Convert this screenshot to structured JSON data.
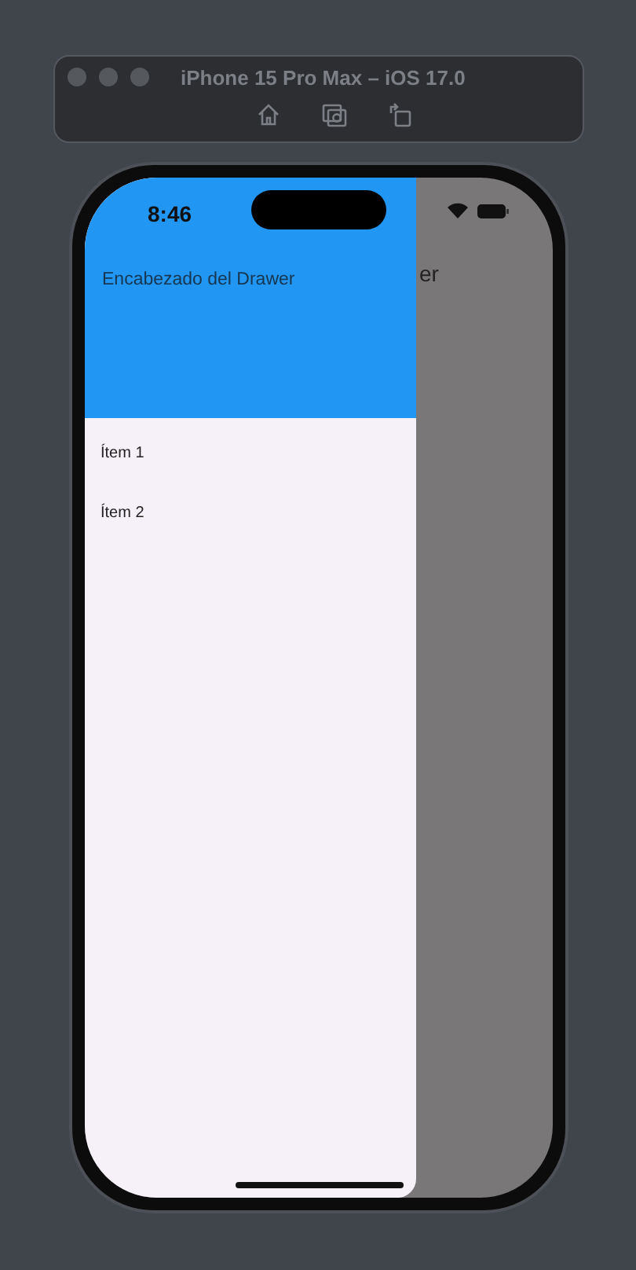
{
  "simulator": {
    "title": "iPhone 15 Pro Max – iOS 17.0"
  },
  "status_bar": {
    "time": "8:46"
  },
  "app_bar": {
    "title": "er"
  },
  "drawer": {
    "header": "Encabezado del Drawer",
    "items": [
      {
        "label": "Ítem 1"
      },
      {
        "label": "Ítem 2"
      }
    ]
  }
}
